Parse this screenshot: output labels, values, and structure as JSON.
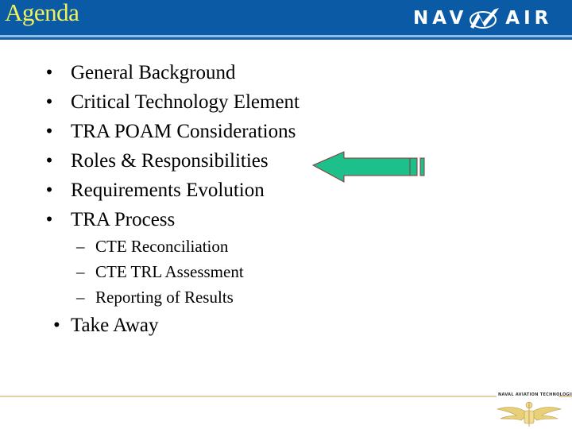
{
  "slide": {
    "title": "Agenda",
    "logo_text_left": "NAV",
    "logo_text_right": "AIR",
    "bullet_glyph": "•",
    "sub_glyph": "–",
    "bullets": [
      {
        "label": "General Background"
      },
      {
        "label": "Critical Technology Element"
      },
      {
        "label": "TRA POAM Considerations"
      },
      {
        "label": "Roles & Responsibilities",
        "highlighted": true
      },
      {
        "label": "Requirements Evolution"
      },
      {
        "label": "TRA Process"
      }
    ],
    "sub_bullets": [
      {
        "label": "CTE Reconciliation"
      },
      {
        "label": "CTE TRL Assessment"
      },
      {
        "label": "Reporting of Results"
      }
    ],
    "final_bullet": "Take Away",
    "footer_emblem_label": "NAVAL AVIATION TECHNOLOGIES",
    "colors": {
      "header_bg": "#0b5aa6",
      "title": "#f2f25a",
      "arrow_fill": "#1dbf8a",
      "arrow_stroke": "#8a3a3a",
      "footer_line": "#e4d0a8"
    }
  }
}
